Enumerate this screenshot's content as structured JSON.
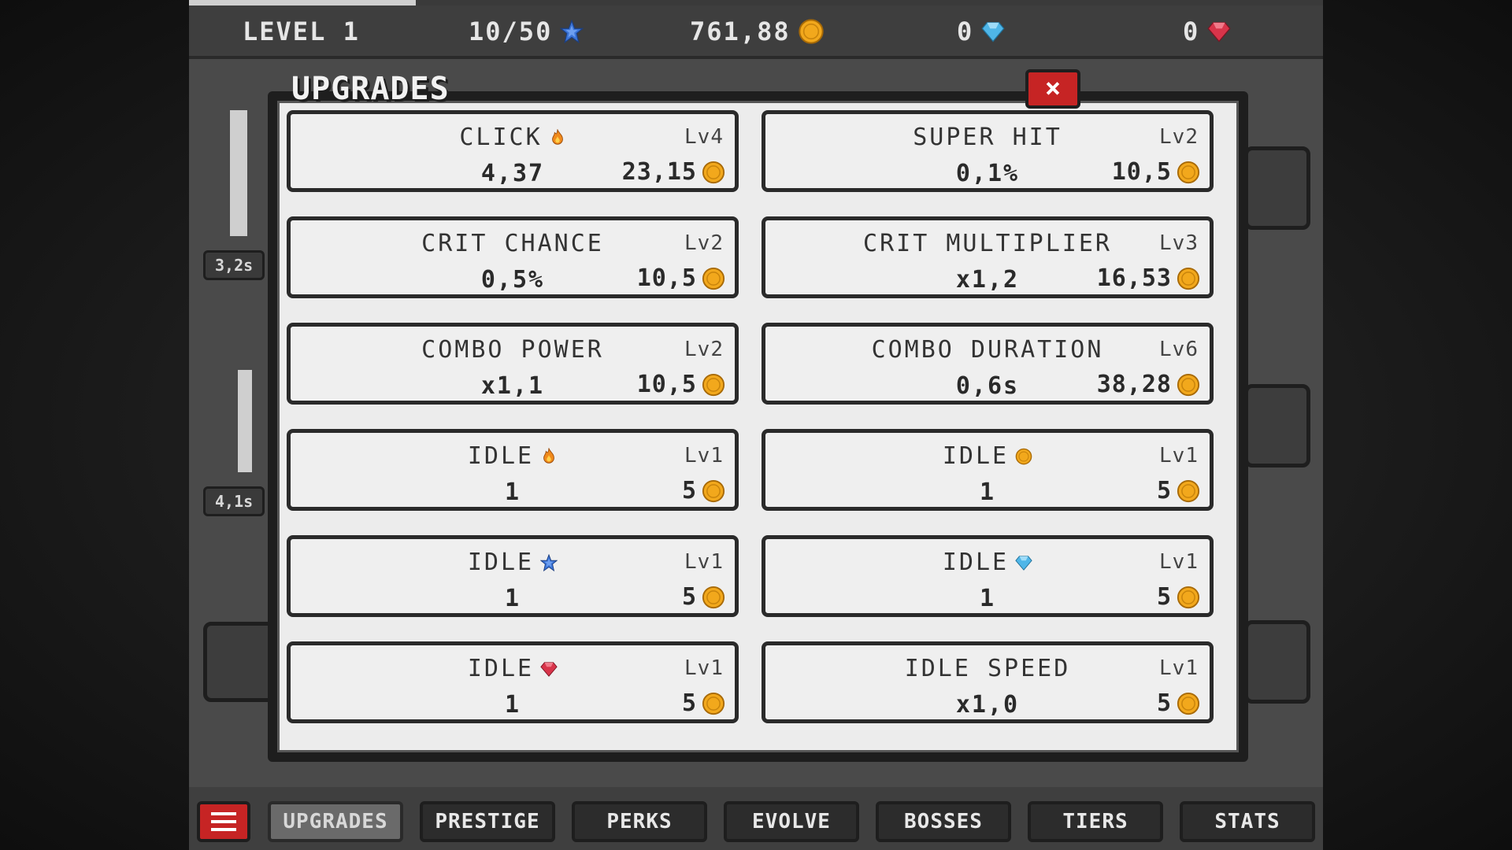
{
  "hud": {
    "level_label": "LEVEL 1",
    "stars": "10/50",
    "coins": "761,88",
    "diamonds": "0",
    "rubies": "0",
    "xp_progress": 0.2
  },
  "side": {
    "timer_1": "3,2s",
    "timer_2": "4,1s"
  },
  "modal": {
    "title": "UPGRADES",
    "close_label": "×"
  },
  "upgrades": [
    {
      "name": "CLICK",
      "icon": "flame-icon",
      "level": "Lv4",
      "value": "4,37",
      "cost": "23,15"
    },
    {
      "name": "SUPER HIT",
      "icon": "",
      "level": "Lv2",
      "value": "0,1%",
      "cost": "10,5"
    },
    {
      "name": "CRIT CHANCE",
      "icon": "",
      "level": "Lv2",
      "value": "0,5%",
      "cost": "10,5"
    },
    {
      "name": "CRIT MULTIPLIER",
      "icon": "",
      "level": "Lv3",
      "value": "x1,2",
      "cost": "16,53"
    },
    {
      "name": "COMBO POWER",
      "icon": "",
      "level": "Lv2",
      "value": "x1,1",
      "cost": "10,5"
    },
    {
      "name": "COMBO DURATION",
      "icon": "",
      "level": "Lv6",
      "value": "0,6s",
      "cost": "38,28"
    },
    {
      "name": "IDLE",
      "icon": "flame-icon",
      "level": "Lv1",
      "value": "1",
      "cost": "5"
    },
    {
      "name": "IDLE",
      "icon": "coin-icon",
      "level": "Lv1",
      "value": "1",
      "cost": "5"
    },
    {
      "name": "IDLE",
      "icon": "star-icon",
      "level": "Lv1",
      "value": "1",
      "cost": "5"
    },
    {
      "name": "IDLE",
      "icon": "diamond-icon",
      "level": "Lv1",
      "value": "1",
      "cost": "5"
    },
    {
      "name": "IDLE",
      "icon": "ruby-icon",
      "level": "Lv1",
      "value": "1",
      "cost": "5"
    },
    {
      "name": "IDLE SPEED",
      "icon": "",
      "level": "Lv1",
      "value": "x1,0",
      "cost": "5"
    }
  ],
  "tabs": [
    "UPGRADES",
    "PRESTIGE",
    "PERKS",
    "EVOLVE",
    "BOSSES",
    "TIERS",
    "STATS"
  ],
  "active_tab": "UPGRADES",
  "colors": {
    "accent_red": "#c62424",
    "coin": "#f2a81c",
    "star": "#3b74d8",
    "diamond": "#4fb6e8",
    "ruby": "#d8344a",
    "flame": "#f08a1c"
  }
}
